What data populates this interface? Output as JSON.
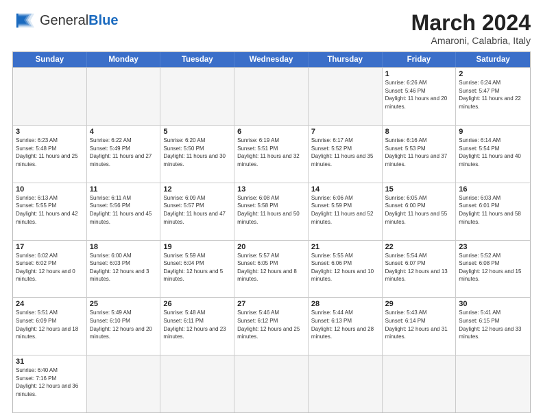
{
  "header": {
    "logo_general": "General",
    "logo_blue": "Blue",
    "month_title": "March 2024",
    "location": "Amaroni, Calabria, Italy"
  },
  "days_of_week": [
    "Sunday",
    "Monday",
    "Tuesday",
    "Wednesday",
    "Thursday",
    "Friday",
    "Saturday"
  ],
  "weeks": [
    [
      {
        "day": "",
        "empty": true
      },
      {
        "day": "",
        "empty": true
      },
      {
        "day": "",
        "empty": true
      },
      {
        "day": "",
        "empty": true
      },
      {
        "day": "",
        "empty": true
      },
      {
        "day": "1",
        "sunrise": "Sunrise: 6:26 AM",
        "sunset": "Sunset: 5:46 PM",
        "daylight": "Daylight: 11 hours and 20 minutes."
      },
      {
        "day": "2",
        "sunrise": "Sunrise: 6:24 AM",
        "sunset": "Sunset: 5:47 PM",
        "daylight": "Daylight: 11 hours and 22 minutes."
      }
    ],
    [
      {
        "day": "3",
        "sunrise": "Sunrise: 6:23 AM",
        "sunset": "Sunset: 5:48 PM",
        "daylight": "Daylight: 11 hours and 25 minutes."
      },
      {
        "day": "4",
        "sunrise": "Sunrise: 6:22 AM",
        "sunset": "Sunset: 5:49 PM",
        "daylight": "Daylight: 11 hours and 27 minutes."
      },
      {
        "day": "5",
        "sunrise": "Sunrise: 6:20 AM",
        "sunset": "Sunset: 5:50 PM",
        "daylight": "Daylight: 11 hours and 30 minutes."
      },
      {
        "day": "6",
        "sunrise": "Sunrise: 6:19 AM",
        "sunset": "Sunset: 5:51 PM",
        "daylight": "Daylight: 11 hours and 32 minutes."
      },
      {
        "day": "7",
        "sunrise": "Sunrise: 6:17 AM",
        "sunset": "Sunset: 5:52 PM",
        "daylight": "Daylight: 11 hours and 35 minutes."
      },
      {
        "day": "8",
        "sunrise": "Sunrise: 6:16 AM",
        "sunset": "Sunset: 5:53 PM",
        "daylight": "Daylight: 11 hours and 37 minutes."
      },
      {
        "day": "9",
        "sunrise": "Sunrise: 6:14 AM",
        "sunset": "Sunset: 5:54 PM",
        "daylight": "Daylight: 11 hours and 40 minutes."
      }
    ],
    [
      {
        "day": "10",
        "sunrise": "Sunrise: 6:13 AM",
        "sunset": "Sunset: 5:55 PM",
        "daylight": "Daylight: 11 hours and 42 minutes."
      },
      {
        "day": "11",
        "sunrise": "Sunrise: 6:11 AM",
        "sunset": "Sunset: 5:56 PM",
        "daylight": "Daylight: 11 hours and 45 minutes."
      },
      {
        "day": "12",
        "sunrise": "Sunrise: 6:09 AM",
        "sunset": "Sunset: 5:57 PM",
        "daylight": "Daylight: 11 hours and 47 minutes."
      },
      {
        "day": "13",
        "sunrise": "Sunrise: 6:08 AM",
        "sunset": "Sunset: 5:58 PM",
        "daylight": "Daylight: 11 hours and 50 minutes."
      },
      {
        "day": "14",
        "sunrise": "Sunrise: 6:06 AM",
        "sunset": "Sunset: 5:59 PM",
        "daylight": "Daylight: 11 hours and 52 minutes."
      },
      {
        "day": "15",
        "sunrise": "Sunrise: 6:05 AM",
        "sunset": "Sunset: 6:00 PM",
        "daylight": "Daylight: 11 hours and 55 minutes."
      },
      {
        "day": "16",
        "sunrise": "Sunrise: 6:03 AM",
        "sunset": "Sunset: 6:01 PM",
        "daylight": "Daylight: 11 hours and 58 minutes."
      }
    ],
    [
      {
        "day": "17",
        "sunrise": "Sunrise: 6:02 AM",
        "sunset": "Sunset: 6:02 PM",
        "daylight": "Daylight: 12 hours and 0 minutes."
      },
      {
        "day": "18",
        "sunrise": "Sunrise: 6:00 AM",
        "sunset": "Sunset: 6:03 PM",
        "daylight": "Daylight: 12 hours and 3 minutes."
      },
      {
        "day": "19",
        "sunrise": "Sunrise: 5:59 AM",
        "sunset": "Sunset: 6:04 PM",
        "daylight": "Daylight: 12 hours and 5 minutes."
      },
      {
        "day": "20",
        "sunrise": "Sunrise: 5:57 AM",
        "sunset": "Sunset: 6:05 PM",
        "daylight": "Daylight: 12 hours and 8 minutes."
      },
      {
        "day": "21",
        "sunrise": "Sunrise: 5:55 AM",
        "sunset": "Sunset: 6:06 PM",
        "daylight": "Daylight: 12 hours and 10 minutes."
      },
      {
        "day": "22",
        "sunrise": "Sunrise: 5:54 AM",
        "sunset": "Sunset: 6:07 PM",
        "daylight": "Daylight: 12 hours and 13 minutes."
      },
      {
        "day": "23",
        "sunrise": "Sunrise: 5:52 AM",
        "sunset": "Sunset: 6:08 PM",
        "daylight": "Daylight: 12 hours and 15 minutes."
      }
    ],
    [
      {
        "day": "24",
        "sunrise": "Sunrise: 5:51 AM",
        "sunset": "Sunset: 6:09 PM",
        "daylight": "Daylight: 12 hours and 18 minutes."
      },
      {
        "day": "25",
        "sunrise": "Sunrise: 5:49 AM",
        "sunset": "Sunset: 6:10 PM",
        "daylight": "Daylight: 12 hours and 20 minutes."
      },
      {
        "day": "26",
        "sunrise": "Sunrise: 5:48 AM",
        "sunset": "Sunset: 6:11 PM",
        "daylight": "Daylight: 12 hours and 23 minutes."
      },
      {
        "day": "27",
        "sunrise": "Sunrise: 5:46 AM",
        "sunset": "Sunset: 6:12 PM",
        "daylight": "Daylight: 12 hours and 25 minutes."
      },
      {
        "day": "28",
        "sunrise": "Sunrise: 5:44 AM",
        "sunset": "Sunset: 6:13 PM",
        "daylight": "Daylight: 12 hours and 28 minutes."
      },
      {
        "day": "29",
        "sunrise": "Sunrise: 5:43 AM",
        "sunset": "Sunset: 6:14 PM",
        "daylight": "Daylight: 12 hours and 31 minutes."
      },
      {
        "day": "30",
        "sunrise": "Sunrise: 5:41 AM",
        "sunset": "Sunset: 6:15 PM",
        "daylight": "Daylight: 12 hours and 33 minutes."
      }
    ],
    [
      {
        "day": "31",
        "sunrise": "Sunrise: 6:40 AM",
        "sunset": "Sunset: 7:16 PM",
        "daylight": "Daylight: 12 hours and 36 minutes."
      },
      {
        "day": "",
        "empty": true
      },
      {
        "day": "",
        "empty": true
      },
      {
        "day": "",
        "empty": true
      },
      {
        "day": "",
        "empty": true
      },
      {
        "day": "",
        "empty": true
      },
      {
        "day": "",
        "empty": true
      }
    ]
  ]
}
